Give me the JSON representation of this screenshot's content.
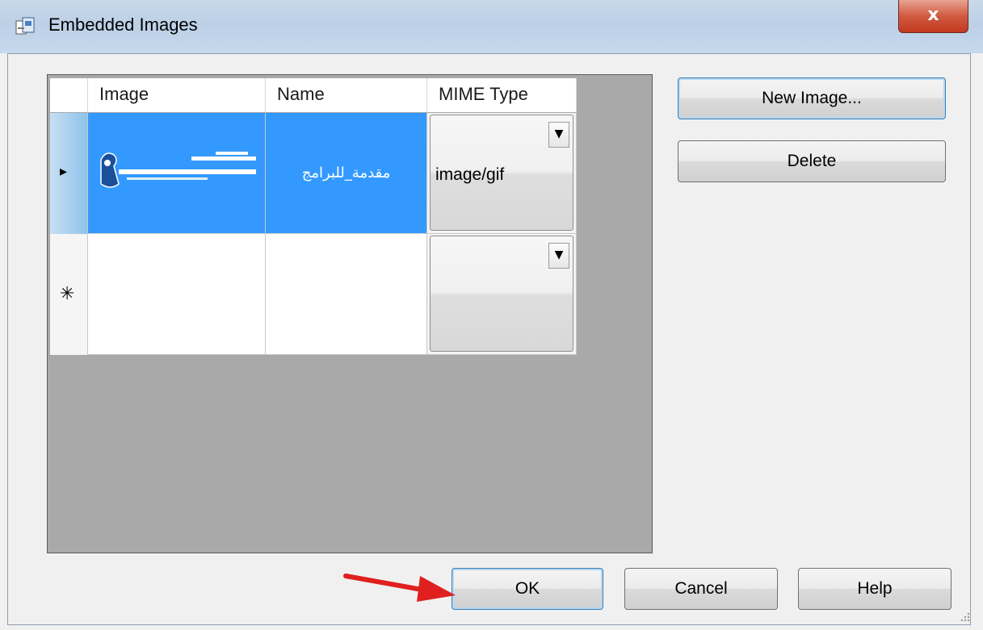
{
  "window": {
    "title": "Embedded Images",
    "close_label": "x"
  },
  "grid": {
    "columns": [
      "Image",
      "Name",
      "MIME Type"
    ],
    "rows": [
      {
        "name": "مقدمة_للبرامج",
        "mime": "image/gif",
        "row_marker": "▸",
        "selected": true
      },
      {
        "name": "",
        "mime": "",
        "row_marker": "✳",
        "selected": false
      }
    ]
  },
  "buttons": {
    "new_image": "New Image...",
    "delete": "Delete",
    "ok": "OK",
    "cancel": "Cancel",
    "help": "Help"
  },
  "colors": {
    "selection": "#3399ff",
    "annotation_arrow": "#e02020"
  }
}
